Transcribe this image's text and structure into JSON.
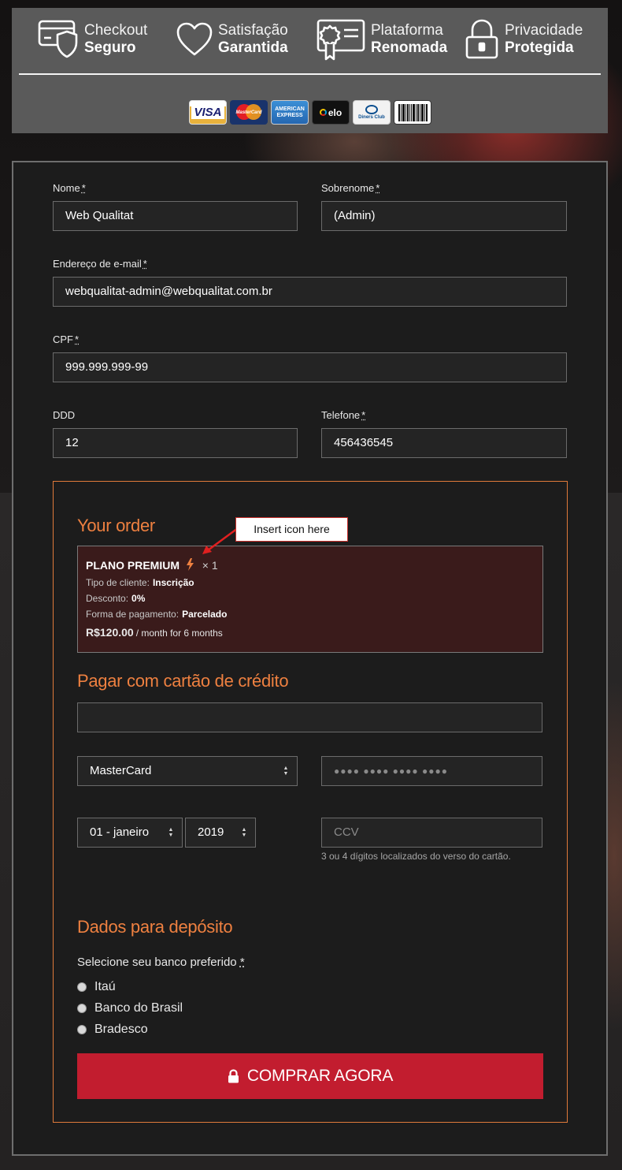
{
  "trust_bar": {
    "badges": [
      {
        "line1": "Checkout",
        "line2": "Seguro",
        "icon": "credit-card-shield-icon"
      },
      {
        "line1": "Satisfação",
        "line2": "Garantida",
        "icon": "heart-icon"
      },
      {
        "line1": "Plataforma",
        "line2": "Renomada",
        "icon": "certificate-icon"
      },
      {
        "line1": "Privacidade",
        "line2": "Protegida",
        "icon": "padlock-icon"
      }
    ],
    "payment_methods": [
      {
        "name": "visa-card-icon",
        "label": "VISA"
      },
      {
        "name": "mastercard-card-icon",
        "label": "MasterCard"
      },
      {
        "name": "amex-card-icon",
        "label": "AMERICAN EXPRESS"
      },
      {
        "name": "elo-card-icon",
        "label": "elo"
      },
      {
        "name": "diners-card-icon",
        "label": "Diners Club"
      },
      {
        "name": "boleto-barcode-icon",
        "label": ""
      }
    ]
  },
  "form": {
    "first_name": {
      "label": "Nome",
      "required_mark": "*",
      "value": "Web Qualitat"
    },
    "last_name": {
      "label": "Sobrenome",
      "required_mark": "*",
      "value": "(Admin)"
    },
    "email": {
      "label": "Endereço de e-mail",
      "required_mark": "*",
      "value": "webqualitat-admin@webqualitat.com.br"
    },
    "cpf": {
      "label": "CPF",
      "required_mark": "*",
      "value": "999.999.999-99"
    },
    "ddd": {
      "label": "DDD",
      "value": "12"
    },
    "phone": {
      "label": "Telefone",
      "required_mark": "*",
      "value": "456436545"
    }
  },
  "order": {
    "title": "Your order",
    "plan_name": "PLANO PREMIUM",
    "plan_icon": "lightning-bolt-icon",
    "quantity": "× 1",
    "client_type_label": "Tipo de cliente:",
    "client_type_value": "Inscrição",
    "discount_label": "Desconto:",
    "discount_value": "0%",
    "payment_form_label": "Forma de pagamento:",
    "payment_form_value": "Parcelado",
    "price": "R$120.00",
    "price_suffix": "/ month for 6 months"
  },
  "annotation": {
    "text": "Insert icon here",
    "color": "#e02020"
  },
  "card_payment": {
    "title": "Pagar com cartão de crédito",
    "holder_value": "",
    "brand_selected": "MasterCard",
    "card_number_placeholder": "●●●● ●●●● ●●●● ●●●●",
    "month_selected": "01 - janeiro",
    "year_selected": "2019",
    "cvv_placeholder": "CCV",
    "cvv_hint": "3 ou 4 dígitos localizados do verso do cartão."
  },
  "deposit": {
    "title": "Dados para depósito",
    "prompt": "Selecione seu banco preferido",
    "required_mark": "*",
    "banks": [
      "Itaú",
      "Banco do Brasil",
      "Bradesco"
    ]
  },
  "submit": {
    "label": "COMPRAR AGORA",
    "icon": "lock-icon"
  },
  "colors": {
    "accent_orange": "#ee8040",
    "button_red": "#c21d2f",
    "panel_bg": "#1c1c1c",
    "trust_bar_bg": "#5a5a5a",
    "order_summary_bg": "#3a1b1b"
  }
}
